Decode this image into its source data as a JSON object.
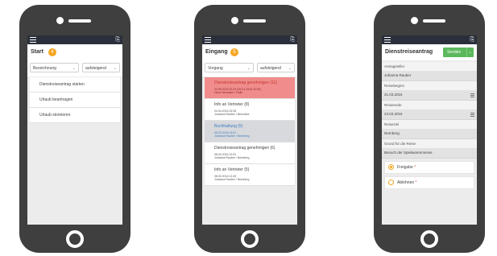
{
  "screen1": {
    "title": "Start",
    "badge": "4",
    "sort_field": "Bezeichnung",
    "sort_order": "aufsteigend",
    "menu": [
      {
        "label": "Dienstreiseantrag starten"
      },
      {
        "label": "Urlaub beantragen"
      },
      {
        "label": "Urlaub stornieren"
      }
    ]
  },
  "screen2": {
    "title": "Eingang",
    "badge": "5",
    "sort_field": "Vorgang",
    "sort_order": "aufsteigend",
    "messages": [
      {
        "title": "Dienstreiseantrag genehmigen (11)",
        "date": "30.06.2016 20:19 (06.01.2016 22:54)",
        "sender": "Hans Neumann / Halle",
        "status": "urgent"
      },
      {
        "title": "Info an Vertreter (8)",
        "date": "04.04.2016 15:39",
        "sender": "Johanna Rauber / Benshine",
        "status": "normal"
      },
      {
        "title": "Buchhaltung (5)",
        "date": "08.03.2016 13:01",
        "sender": "Johanna Rauber / Nürnberg",
        "status": "unread"
      },
      {
        "title": "Dienstreiseantrag genehmigen (6)",
        "date": "08.03.2016 12:51",
        "sender": "Johanna Rauber / Nürnberg",
        "status": "normal"
      },
      {
        "title": "Info an Vertreter (5)",
        "date": "08.03.2016 12:49",
        "sender": "Johanna Rauber / Nürnberg",
        "status": "normal"
      }
    ]
  },
  "screen3": {
    "title": "Dienstreiseantrag",
    "send_label": "Senden",
    "fields": [
      {
        "label": "Antragsteller",
        "value": "Johanna Rauber",
        "calendar": false
      },
      {
        "label": "Reisebeginn",
        "value": "21.03.2016",
        "calendar": true
      },
      {
        "label": "Reiseende",
        "value": "23.03.2016",
        "calendar": true
      },
      {
        "label": "Reiseziel",
        "value": "Nürnberg",
        "calendar": false
      },
      {
        "label": "Grund für die Reise",
        "value": "Besuch der Spielwarenmesse",
        "calendar": false
      }
    ],
    "options": [
      {
        "label": "Freigabe",
        "required": "*",
        "selected": true
      },
      {
        "label": "Ablehnen",
        "required": "*",
        "selected": false
      }
    ]
  },
  "colors": {
    "accent": "#f5a623",
    "topbar": "#2a2f3b",
    "send": "#5cb85c",
    "urgent": "#f08c8c",
    "unread_text": "#3b7bbf"
  }
}
